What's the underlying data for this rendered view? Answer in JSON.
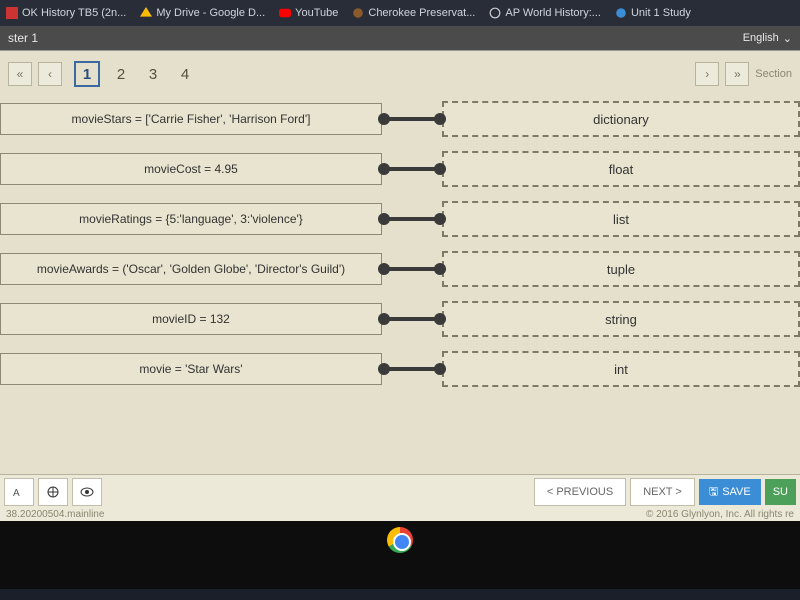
{
  "browserTabs": [
    {
      "label": "OK History TB5 (2n..."
    },
    {
      "label": "My Drive - Google D..."
    },
    {
      "label": "YouTube"
    },
    {
      "label": "Cherokee Preservat..."
    },
    {
      "label": "AP World History:..."
    },
    {
      "label": "Unit 1 Study"
    }
  ],
  "bar": {
    "left": "ster 1",
    "lang": "English"
  },
  "pages": [
    "1",
    "2",
    "3",
    "4"
  ],
  "sectionLabel": "Section",
  "matches": [
    {
      "left": "movieStars = ['Carrie Fisher', 'Harrison Ford']",
      "right": "dictionary"
    },
    {
      "left": "movieCost = 4.95",
      "right": "float"
    },
    {
      "left": "movieRatings = {5:'language', 3:'violence'}",
      "right": "list"
    },
    {
      "left": "movieAwards = ('Oscar', 'Golden Globe', 'Director's Guild')",
      "right": "tuple"
    },
    {
      "left": "movieID = 132",
      "right": "string"
    },
    {
      "left": "movie = 'Star Wars'",
      "right": "int"
    }
  ],
  "footer": {
    "prev": "<  PREVIOUS",
    "next": "NEXT  >",
    "save": "SAVE",
    "submit": "SU",
    "version": "38.20200504.mainline",
    "copyright": "© 2016 Glynlyon, Inc. All rights re"
  }
}
